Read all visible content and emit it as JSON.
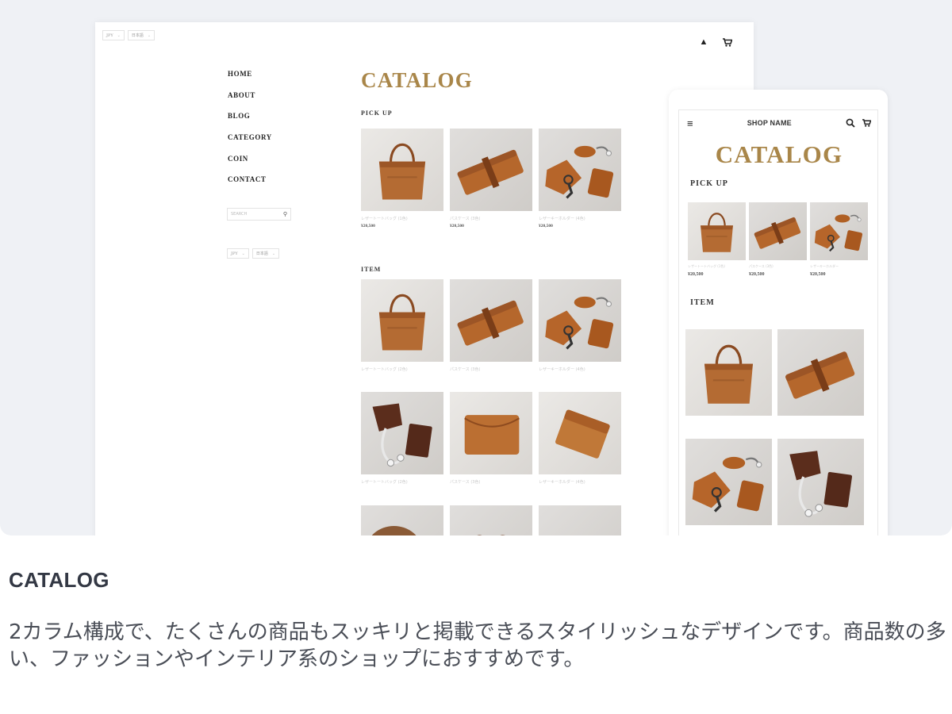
{
  "desktop": {
    "header_selects": [
      {
        "value": "JPY"
      },
      {
        "value": "日本語"
      }
    ],
    "nav_items": [
      "HOME",
      "ABOUT",
      "BLOG",
      "CATEGORY",
      "COIN",
      "CONTACT"
    ],
    "search_placeholder": "SEARCH",
    "sidebar_selects": [
      {
        "value": "JPY"
      },
      {
        "value": "日本語"
      }
    ],
    "page_title": "CATALOG",
    "pickup_heading": "PICK UP",
    "pickup_items": [
      {
        "name": "レザートートバッグ (1色)",
        "price": "¥20,500",
        "image": "tote-bag"
      },
      {
        "name": "パスケース (3色)",
        "price": "¥20,500",
        "image": "roll-case"
      },
      {
        "name": "レザーキーホルダー (4色)",
        "price": "¥20,500",
        "image": "key-holder"
      }
    ],
    "item_heading": "ITEM",
    "items": [
      {
        "name": "レザートートバッグ (2色)",
        "image": "tote-bag"
      },
      {
        "name": "パスケース (3色)",
        "image": "roll-case"
      },
      {
        "name": "レザーキーホルダー (4色)",
        "image": "key-holder"
      },
      {
        "name": "レザートートバッグ (2色)",
        "image": "cord-case"
      },
      {
        "name": "パスケース (3色)",
        "image": "wallet"
      },
      {
        "name": "レザーキーホルダー (4色)",
        "image": "card-case"
      },
      {
        "name": "",
        "image": "rope"
      },
      {
        "name": "",
        "image": "shoes"
      },
      {
        "name": "",
        "image": "tray"
      }
    ]
  },
  "mobile": {
    "shop_name": "SHOP NAME",
    "page_title": "CATALOG",
    "pickup_heading": "PICK UP",
    "pickup_items": [
      {
        "name": "レザートートバッグ (1色)",
        "price": "¥20,500",
        "image": "tote-bag"
      },
      {
        "name": "パスケース (3色)",
        "price": "¥20,500",
        "image": "roll-case"
      },
      {
        "name": "レザーキーホルダー",
        "price": "¥20,500",
        "image": "key-holder"
      }
    ],
    "item_heading": "ITEM",
    "items": [
      {
        "image": "tote-bag"
      },
      {
        "image": "roll-case"
      },
      {
        "image": "key-holder"
      },
      {
        "image": "cord-case"
      }
    ]
  },
  "caption": {
    "title": "CATALOG",
    "description": "2カラム構成で、たくさんの商品もスッキリと掲載できるスタイリッシュなデザインです。商品数の多い、ファッションやインテリア系のショップにおすすめです。"
  },
  "colors": {
    "accent_gold": "#a98649",
    "preview_background": "#eff1f5",
    "leather": "#b46b33"
  },
  "icons": [
    "user-icon",
    "cart-icon",
    "search-icon",
    "menu-icon"
  ]
}
